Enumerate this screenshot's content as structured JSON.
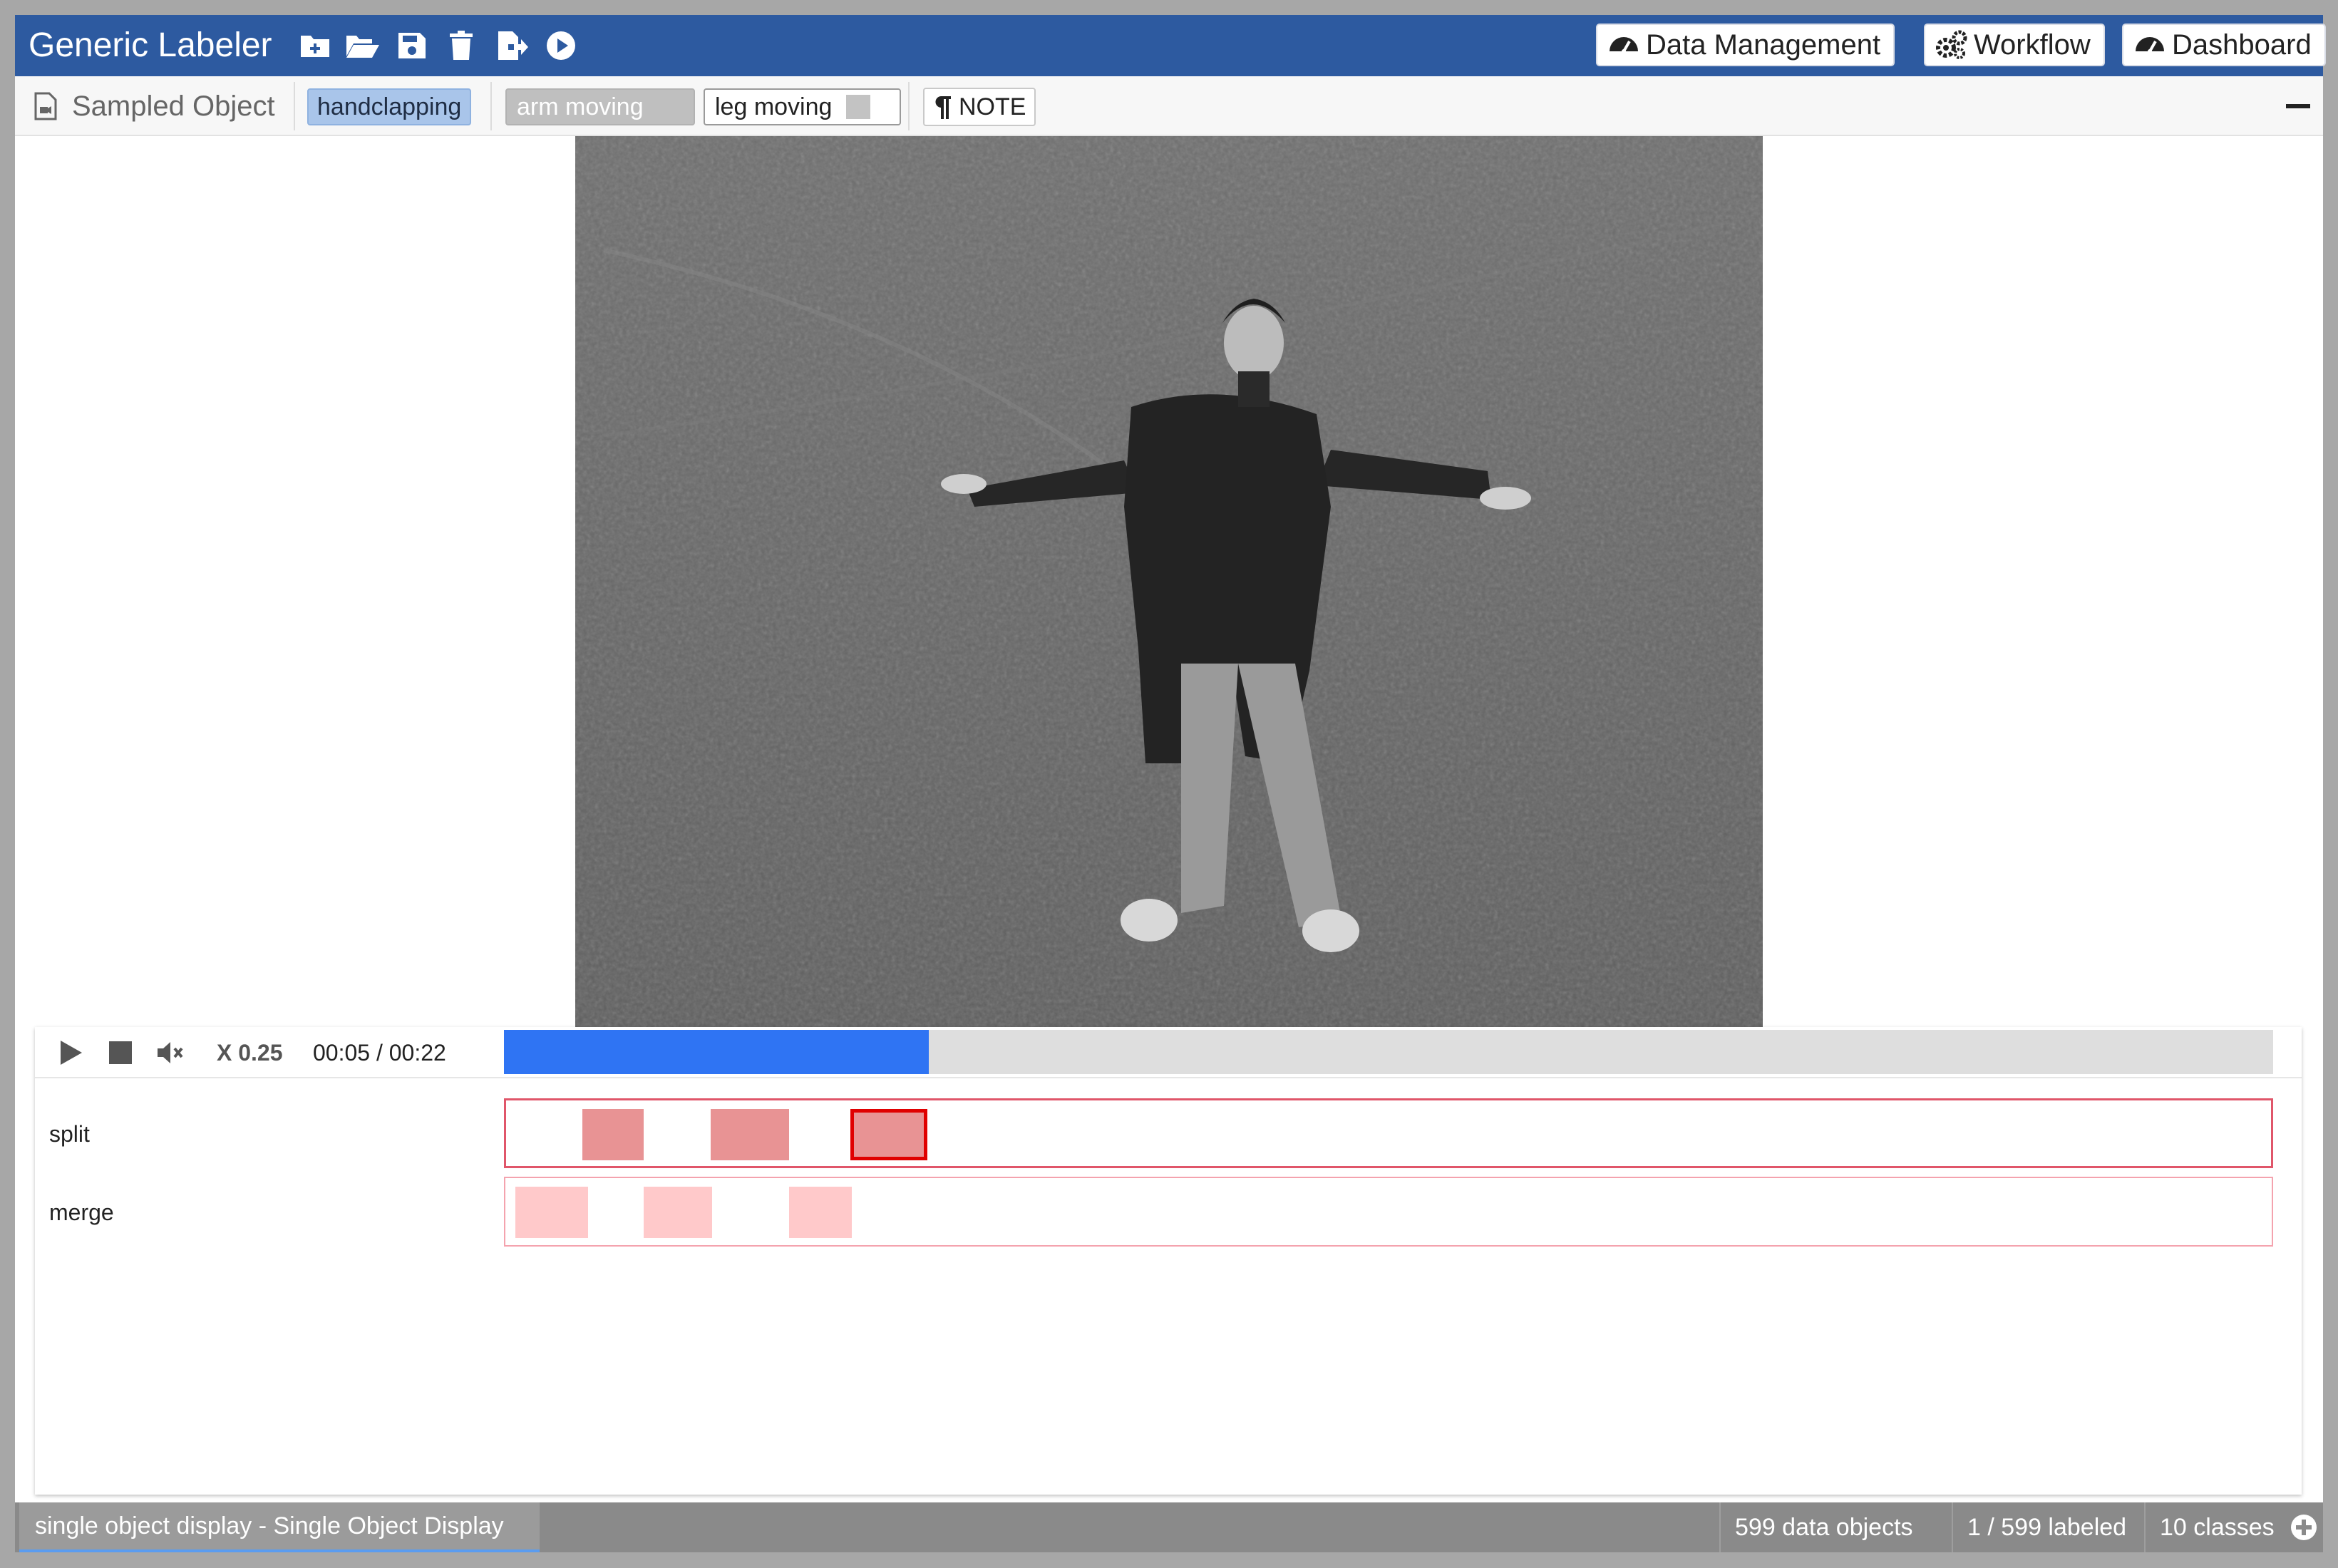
{
  "app": {
    "title": "Generic Labeler"
  },
  "toolbar_icons": [
    "add-file-icon",
    "folder-open-icon",
    "save-icon",
    "trash-icon",
    "export-icon",
    "play-circle-icon"
  ],
  "nav": [
    {
      "label": "Data Management",
      "icon": "gauge-icon"
    },
    {
      "label": "Workflow",
      "icon": "gears-icon"
    },
    {
      "label": "Dashboard",
      "icon": "gauge-icon"
    }
  ],
  "labelbar": {
    "object_label": "Sampled Object",
    "selected_class": "handclapping",
    "tags": [
      "arm moving",
      "leg moving"
    ],
    "note_label": "NOTE"
  },
  "player": {
    "speed": "X 0.25",
    "time": "00:05 / 00:22",
    "progress_fraction": 0.24,
    "tracks": [
      {
        "name": "split"
      },
      {
        "name": "merge"
      }
    ]
  },
  "footer": {
    "tab": "single object display - Single Object Display",
    "data_objects": "599 data objects",
    "labeled": "1 / 599 labeled",
    "classes": "10 classes"
  },
  "colors": {
    "header": "#2d5aa0",
    "progress": "#2f74f3",
    "split_segment": "#e89394",
    "merge_segment": "#ffc9ca",
    "selected_border": "#e00000"
  }
}
